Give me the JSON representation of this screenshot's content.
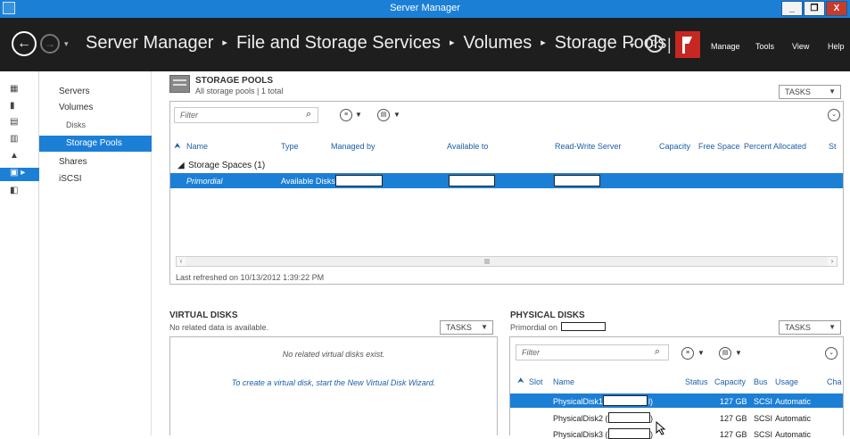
{
  "window": {
    "title": "Server Manager",
    "min": "_",
    "restore": "❐",
    "close": "X"
  },
  "nav": {
    "back_icon": "←",
    "forward_icon": "→",
    "dropdown": "▾",
    "crumbs": [
      "Server Manager",
      "File and Storage Services",
      "Volumes",
      "Storage Pools"
    ],
    "sep": "▸",
    "refresh_dd": "▾",
    "refresh_icon": "⟳",
    "pipe": "|",
    "menu": [
      "Manage",
      "Tools",
      "View",
      "Help"
    ]
  },
  "sidebar": {
    "icons": [
      "dashboard-icon",
      "local-server-icon",
      "all-servers-icon",
      "file-services-icon",
      "storage-icon",
      "volumes-icon",
      "iscsi-icon"
    ],
    "items": [
      {
        "label": "Servers"
      },
      {
        "label": "Volumes"
      },
      {
        "label": "Disks"
      },
      {
        "label": "Storage Pools"
      },
      {
        "label": "Shares"
      },
      {
        "label": "iSCSI"
      }
    ]
  },
  "pools": {
    "title": "STORAGE POOLS",
    "subtitle": "All storage pools | 1 total",
    "tasks": "TASKS",
    "filter_placeholder": "Filter",
    "columns": [
      "Name",
      "Type",
      "Managed by",
      "Available to",
      "Read-Write Server",
      "Capacity",
      "Free Space",
      "Percent Allocated",
      "St"
    ],
    "group": "Storage Spaces (1)",
    "row": {
      "name": "Primordial",
      "type": "Available Disks"
    },
    "refreshed": "Last refreshed on 10/13/2012 1:39:22 PM"
  },
  "virtual_disks": {
    "title": "VIRTUAL DISKS",
    "subtitle": "No related data is available.",
    "tasks": "TASKS",
    "empty": "No related virtual disks exist.",
    "wizard": "To create a virtual disk, start the New Virtual Disk Wizard."
  },
  "physical_disks": {
    "title": "PHYSICAL DISKS",
    "subtitle": "Primordial on",
    "tasks": "TASKS",
    "filter_placeholder": "Filter",
    "columns": [
      "Slot",
      "Name",
      "Status",
      "Capacity",
      "Bus",
      "Usage",
      "Cha"
    ],
    "rows": [
      {
        "name": "PhysicalDisk1",
        "suffix": "l)",
        "capacity": "127 GB",
        "bus": "SCSI",
        "usage": "Automatic"
      },
      {
        "name": "PhysicalDisk2 (",
        "suffix": ")",
        "capacity": "127 GB",
        "bus": "SCSI",
        "usage": "Automatic"
      },
      {
        "name": "PhysicalDisk3 (",
        "suffix": ")",
        "capacity": "127 GB",
        "bus": "SCSI",
        "usage": "Automatic"
      }
    ]
  }
}
